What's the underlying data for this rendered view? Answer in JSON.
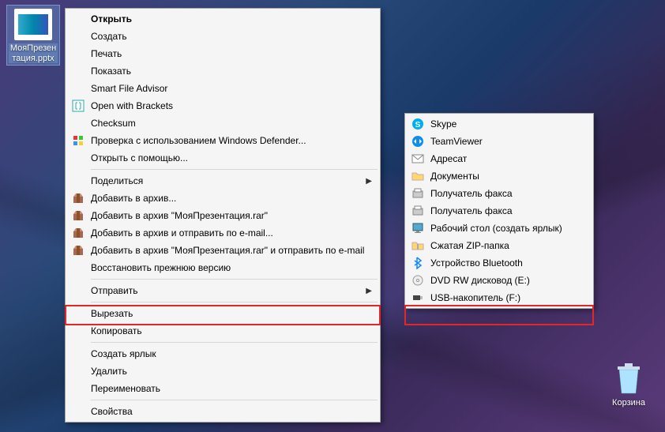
{
  "desktop": {
    "file": {
      "label": "МояПрезентация.pptx"
    },
    "bin": {
      "label": "Корзина"
    }
  },
  "contextMenu": {
    "items": {
      "open": "Открыть",
      "create": "Создать",
      "print": "Печать",
      "show": "Показать",
      "smartfile": "Smart File Advisor",
      "brackets": "Open with Brackets",
      "checksum": "Checksum",
      "defender": "Проверка с использованием Windows Defender...",
      "openwith": "Открыть с помощью...",
      "share": "Поделиться",
      "addArchive": "Добавить в архив...",
      "addArchiveNamed": "Добавить в архив \"МояПрезентация.rar\"",
      "addEmail": "Добавить в архив и отправить по e-mail...",
      "addNamedEmail": "Добавить в архив \"МояПрезентация.rar\" и отправить по e-mail",
      "restore": "Восстановить прежнюю версию",
      "sendto": "Отправить",
      "cut": "Вырезать",
      "copy": "Копировать",
      "shortcut": "Создать ярлык",
      "delete": "Удалить",
      "rename": "Переименовать",
      "properties": "Свойства"
    }
  },
  "sendToMenu": {
    "items": {
      "skype": "Skype",
      "teamviewer": "TeamViewer",
      "recipient": "Адресат",
      "documents": "Документы",
      "fax1": "Получатель факса",
      "fax2": "Получатель факса",
      "desktop": "Рабочий стол (создать ярлык)",
      "zip": "Сжатая ZIP-папка",
      "bluetooth": "Устройство Bluetooth",
      "dvd": "DVD RW дисковод (E:)",
      "usb": "USB-накопитель (F:)"
    }
  }
}
